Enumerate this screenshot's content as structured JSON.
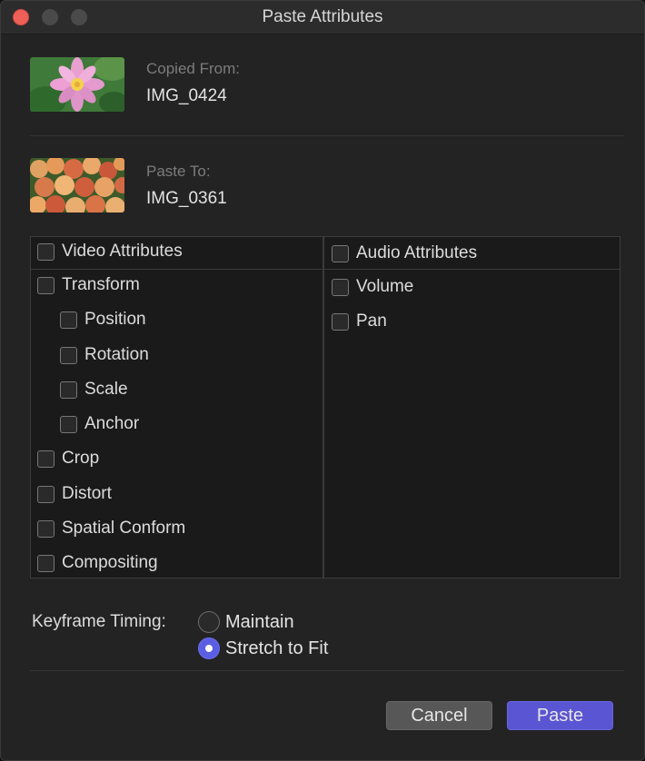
{
  "window": {
    "title": "Paste Attributes"
  },
  "source": {
    "label": "Copied From:",
    "name": "IMG_0424"
  },
  "target": {
    "label": "Paste To:",
    "name": "IMG_0361"
  },
  "video": {
    "header": "Video Attributes",
    "items": [
      {
        "label": "Transform",
        "level": 0,
        "checked": false
      },
      {
        "label": "Position",
        "level": 1,
        "checked": false
      },
      {
        "label": "Rotation",
        "level": 1,
        "checked": false
      },
      {
        "label": "Scale",
        "level": 1,
        "checked": false
      },
      {
        "label": "Anchor",
        "level": 1,
        "checked": false
      },
      {
        "label": "Crop",
        "level": 0,
        "checked": false
      },
      {
        "label": "Distort",
        "level": 0,
        "checked": false
      },
      {
        "label": "Spatial Conform",
        "level": 0,
        "checked": false
      },
      {
        "label": "Compositing",
        "level": 0,
        "checked": false
      }
    ]
  },
  "audio": {
    "header": "Audio Attributes",
    "items": [
      {
        "label": "Volume",
        "checked": false
      },
      {
        "label": "Pan",
        "checked": false
      }
    ]
  },
  "keyframe": {
    "label": "Keyframe Timing:",
    "options": [
      {
        "label": "Maintain",
        "selected": false
      },
      {
        "label": "Stretch to Fit",
        "selected": true
      }
    ]
  },
  "buttons": {
    "cancel": "Cancel",
    "paste": "Paste"
  },
  "colors": {
    "accent": "#5b5ee3",
    "close": "#ee5f58"
  },
  "icons": {
    "source_thumb": "flower-thumbnail",
    "target_thumb": "peaches-thumbnail"
  }
}
